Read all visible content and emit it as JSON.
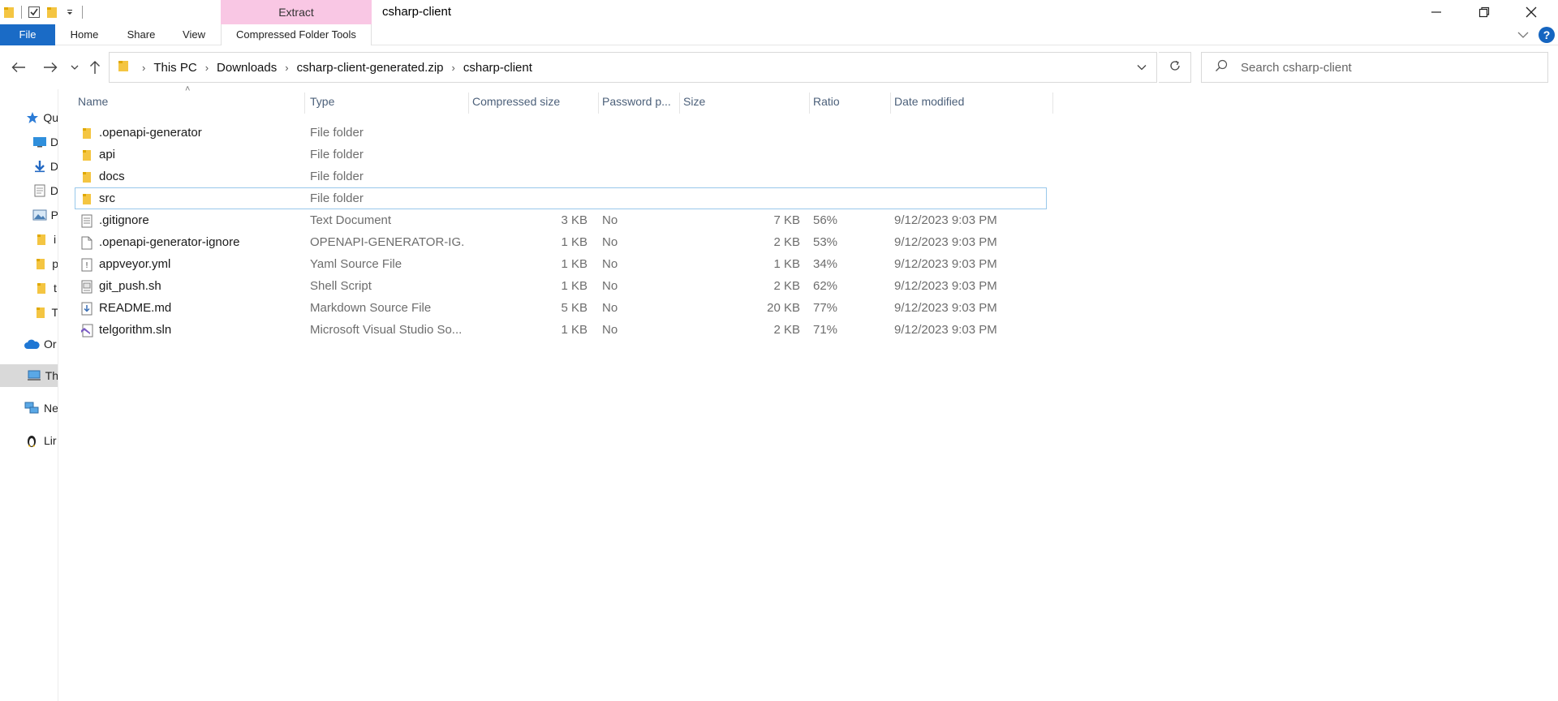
{
  "window": {
    "title": "csharp-client",
    "context_tab_header": "Extract"
  },
  "ribbon": {
    "tabs": [
      {
        "label": "File"
      },
      {
        "label": "Home"
      },
      {
        "label": "Share"
      },
      {
        "label": "View"
      },
      {
        "label": "Compressed Folder Tools"
      }
    ]
  },
  "address": {
    "breadcrumbs": [
      "This PC",
      "Downloads",
      "csharp-client-generated.zip",
      "csharp-client"
    ]
  },
  "search": {
    "placeholder": "Search csharp-client"
  },
  "navpane": {
    "items": [
      {
        "label": "Qu",
        "icon": "star-icon"
      },
      {
        "label": "D",
        "icon": "desktop-icon"
      },
      {
        "label": "D",
        "icon": "download-arrow-icon"
      },
      {
        "label": "D",
        "icon": "document-icon"
      },
      {
        "label": "P",
        "icon": "pictures-icon"
      },
      {
        "label": "i",
        "icon": "folder-icon"
      },
      {
        "label": "p",
        "icon": "folder-icon"
      },
      {
        "label": "t",
        "icon": "folder-icon"
      },
      {
        "label": "T",
        "icon": "folder-icon"
      },
      {
        "label": "Or",
        "icon": "cloud-icon"
      },
      {
        "label": "Th",
        "icon": "computer-icon"
      },
      {
        "label": "Ne",
        "icon": "network-icon"
      },
      {
        "label": "Lir",
        "icon": "linux-penguin-icon"
      }
    ]
  },
  "columns": {
    "name": "Name",
    "type": "Type",
    "compressed_size": "Compressed size",
    "password": "Password p...",
    "size": "Size",
    "ratio": "Ratio",
    "date_modified": "Date modified"
  },
  "files": [
    {
      "name": ".openapi-generator",
      "type": "File folder",
      "compressed": "",
      "password": "",
      "size": "",
      "ratio": "",
      "date": "",
      "icon": "folder-icon"
    },
    {
      "name": "api",
      "type": "File folder",
      "compressed": "",
      "password": "",
      "size": "",
      "ratio": "",
      "date": "",
      "icon": "folder-icon"
    },
    {
      "name": "docs",
      "type": "File folder",
      "compressed": "",
      "password": "",
      "size": "",
      "ratio": "",
      "date": "",
      "icon": "folder-icon"
    },
    {
      "name": "src",
      "type": "File folder",
      "compressed": "",
      "password": "",
      "size": "",
      "ratio": "",
      "date": "",
      "icon": "folder-icon"
    },
    {
      "name": ".gitignore",
      "type": "Text Document",
      "compressed": "3 KB",
      "password": "No",
      "size": "7 KB",
      "ratio": "56%",
      "date": "9/12/2023 9:03 PM",
      "icon": "text-file-icon"
    },
    {
      "name": ".openapi-generator-ignore",
      "type": "OPENAPI-GENERATOR-IG...",
      "compressed": "1 KB",
      "password": "No",
      "size": "2 KB",
      "ratio": "53%",
      "date": "9/12/2023 9:03 PM",
      "icon": "blank-file-icon"
    },
    {
      "name": "appveyor.yml",
      "type": "Yaml Source File",
      "compressed": "1 KB",
      "password": "No",
      "size": "1 KB",
      "ratio": "34%",
      "date": "9/12/2023 9:03 PM",
      "icon": "yaml-file-icon"
    },
    {
      "name": "git_push.sh",
      "type": "Shell Script",
      "compressed": "1 KB",
      "password": "No",
      "size": "2 KB",
      "ratio": "62%",
      "date": "9/12/2023 9:03 PM",
      "icon": "script-file-icon"
    },
    {
      "name": "README.md",
      "type": "Markdown Source File",
      "compressed": "5 KB",
      "password": "No",
      "size": "20 KB",
      "ratio": "77%",
      "date": "9/12/2023 9:03 PM",
      "icon": "markdown-file-icon"
    },
    {
      "name": "telgorithm.sln",
      "type": "Microsoft Visual Studio So...",
      "compressed": "1 KB",
      "password": "No",
      "size": "2 KB",
      "ratio": "71%",
      "date": "9/12/2023 9:03 PM",
      "icon": "visual-studio-solution-icon"
    }
  ],
  "colors": {
    "file_tab": "#1a6bc6",
    "context_tab": "#f9c7e4",
    "folder": "#f4c542",
    "focus_border": "#99c8eb",
    "header_text": "#4c607a",
    "nav_selected": "#d9d9d9"
  }
}
